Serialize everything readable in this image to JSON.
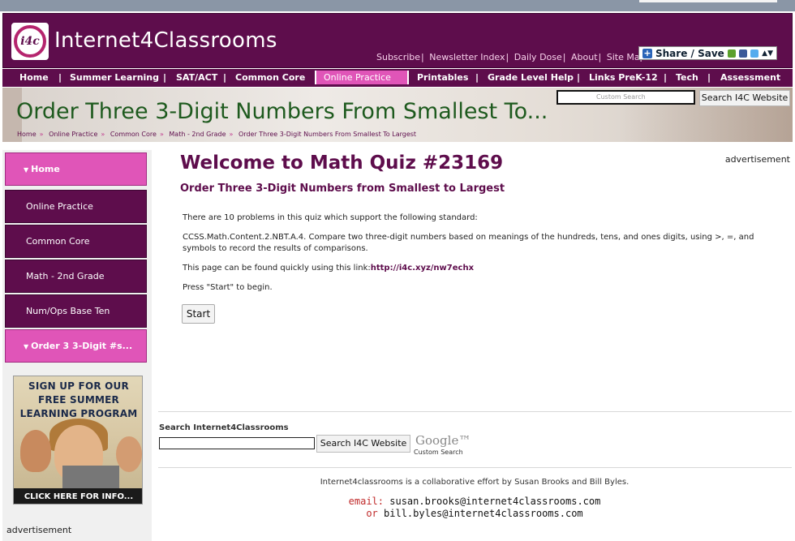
{
  "site": {
    "logo_mark": "i4c",
    "logo_text": "Internet4Classrooms"
  },
  "header_links": [
    "Subscribe",
    "Newsletter Index",
    "Daily Dose",
    "About",
    "Site Map"
  ],
  "share_label": "Share / Save",
  "nav": {
    "items": [
      "Home",
      "Summer Learning",
      "SAT/ACT",
      "Common Core",
      "Online Practice",
      "Printables",
      "Grade Level Help",
      "Links PreK-12",
      "Tech",
      "Assessment"
    ],
    "active": "Online Practice"
  },
  "banner": {
    "title": "Order Three 3-Digit Numbers From Smallest To...",
    "breadcrumbs": [
      "Home",
      "Online Practice",
      "Common Core",
      "Math - 2nd Grade",
      "Order Three 3-Digit Numbers From Smallest To Largest"
    ],
    "search_placeholder": "Custom Search",
    "search_button": "Search I4C Website"
  },
  "sidebar": {
    "items": [
      {
        "label": "Home",
        "active": true
      },
      {
        "label": "Online Practice",
        "active": false
      },
      {
        "label": "Common Core",
        "active": false
      },
      {
        "label": "Math - 2nd Grade",
        "active": false
      },
      {
        "label": "Num/Ops Base Ten",
        "active": false
      },
      {
        "label": "Order 3 3-Digit #s...",
        "active": true
      }
    ],
    "promo": {
      "lines": [
        "SIGN UP FOR OUR",
        "FREE SUMMER",
        "LEARNING PROGRAM"
      ],
      "cta": "CLICK HERE FOR INFO..."
    },
    "ad_label": "advertisement"
  },
  "main": {
    "ad_label": "advertisement",
    "title": "Welcome to Math Quiz #23169",
    "subtitle": "Order Three 3-Digit Numbers from Smallest to Largest",
    "intro": "There are 10 problems in this quiz which support the following standard:",
    "standard_line1": "CCSS.Math.Content.2.NBT.A.4. Compare two three-digit numbers based on meanings of the hundreds, tens, and ones digits, using >, =, and",
    "standard_line2": "symbols to record the results of comparisons.",
    "link_prefix": "This page can be found quickly using this link:",
    "link": "http://i4c.xyz/nw7echx",
    "instruction": "Press \"Start\" to begin.",
    "start_button": "Start"
  },
  "site_search": {
    "heading": "Search Internet4Classrooms",
    "input_value": "",
    "button": "Search I4C Website",
    "google_logo": "Google™",
    "google_sub": "Custom Search"
  },
  "footer": {
    "text": "Internet4classrooms is a collaborative effort by Susan Brooks and Bill Byles.",
    "email_label": "email:",
    "email1": "susan.brooks@internet4classrooms.com",
    "or_label": "or",
    "email2": "bill.byles@internet4classrooms.com"
  }
}
